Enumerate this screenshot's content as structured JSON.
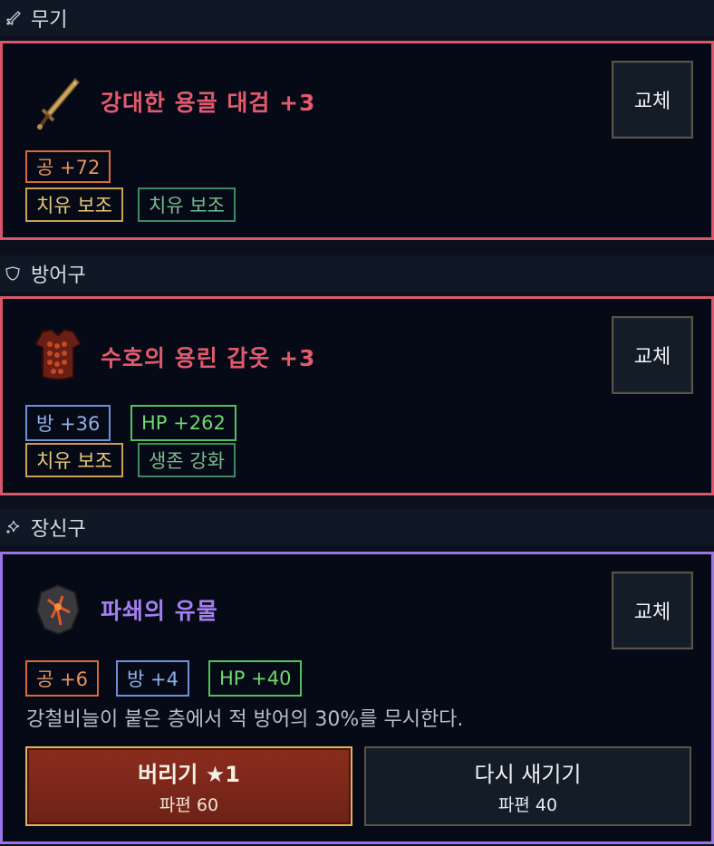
{
  "sections": {
    "weapon": {
      "header": "무기",
      "item_name": "강대한 용골 대검 +3",
      "item_name_color": "#e25a6e",
      "swap_label": "교체",
      "stats": [
        "공 +72"
      ],
      "traits": [
        "치유 보조",
        "치유 보조"
      ]
    },
    "armor": {
      "header": "방어구",
      "item_name": "수호의 용린 갑옷 +3",
      "item_name_color": "#e25a6e",
      "swap_label": "교체",
      "stats": [
        "방 +36",
        "HP +262"
      ],
      "traits": [
        "치유 보조",
        "생존 강화"
      ]
    },
    "accessory": {
      "header": "장신구",
      "item_name": "파쇄의 유물",
      "item_name_color": "#a57ff0",
      "swap_label": "교체",
      "stats": [
        "공 +6",
        "방 +4",
        "HP +40"
      ],
      "description": "강철비늘이 붙은 층에서 적 방어의 30%를 무시한다.",
      "discard": {
        "label": "버리기 ★1",
        "sub": "파편 60"
      },
      "reforge": {
        "label": "다시 새기기",
        "sub": "파편 40"
      }
    }
  },
  "colors": {
    "legendary_border": "#d9576b",
    "epic_border": "#9d74e8",
    "attack": "#d96a3e",
    "defense": "#6f8fd6",
    "hp": "#52c25a"
  },
  "icons": {
    "weapon_header": "sword-icon",
    "armor_header": "shield-icon",
    "accessory_header": "sparkle-icon",
    "weapon_item": "greatsword-icon",
    "armor_item": "scale-armor-icon",
    "accessory_item": "relic-icon"
  }
}
